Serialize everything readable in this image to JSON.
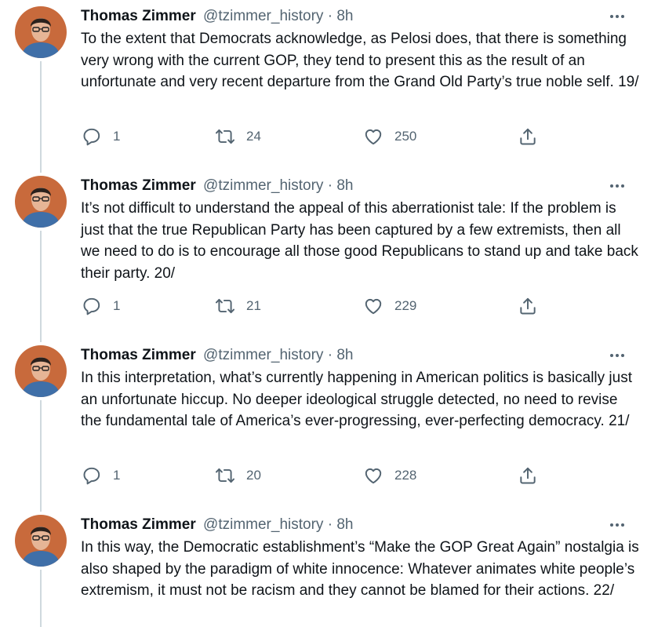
{
  "colors": {
    "text_primary": "#0f1419",
    "text_secondary": "#536471",
    "thread_line": "#cfd9de",
    "avatar_bg": "#c86a3c"
  },
  "icons": {
    "reply": "reply-icon",
    "retweet": "retweet-icon",
    "like": "heart-icon",
    "share": "share-icon",
    "more": "more-icon"
  },
  "tweets": [
    {
      "name": "Thomas Zimmer",
      "handle": "@tzimmer_history",
      "dot": "·",
      "time": "8h",
      "text": "To the extent that Democrats acknowledge, as Pelosi does, that there is something very wrong with the current GOP, they tend to present this as the result of an unfortunate and very recent departure from the Grand Old Party’s true noble self. 19/",
      "replies": "1",
      "retweets": "24",
      "likes": "250"
    },
    {
      "name": "Thomas Zimmer",
      "handle": "@tzimmer_history",
      "dot": "·",
      "time": "8h",
      "text": "It’s not difficult to understand the appeal of this aberrationist tale: If the problem is just that the true Republican Party has been captured by a few extremists, then all we need to do is to encourage all those good Republicans to stand up and take back their party. 20/",
      "replies": "1",
      "retweets": "21",
      "likes": "229"
    },
    {
      "name": "Thomas Zimmer",
      "handle": "@tzimmer_history",
      "dot": "·",
      "time": "8h",
      "text": "In this interpretation, what’s currently happening in American politics is basically just an unfortunate hiccup. No deeper ideological struggle detected, no need to revise the fundamental tale of America’s ever-progressing, ever-perfecting democracy. 21/",
      "replies": "1",
      "retweets": "20",
      "likes": "228"
    },
    {
      "name": "Thomas Zimmer",
      "handle": "@tzimmer_history",
      "dot": "·",
      "time": "8h",
      "text": "In this way, the Democratic establishment’s “Make the GOP Great Again” nostalgia is also shaped by the paradigm of white innocence: Whatever animates white people’s extremism, it must not be racism and they cannot be blamed for their actions. 22/"
    }
  ]
}
